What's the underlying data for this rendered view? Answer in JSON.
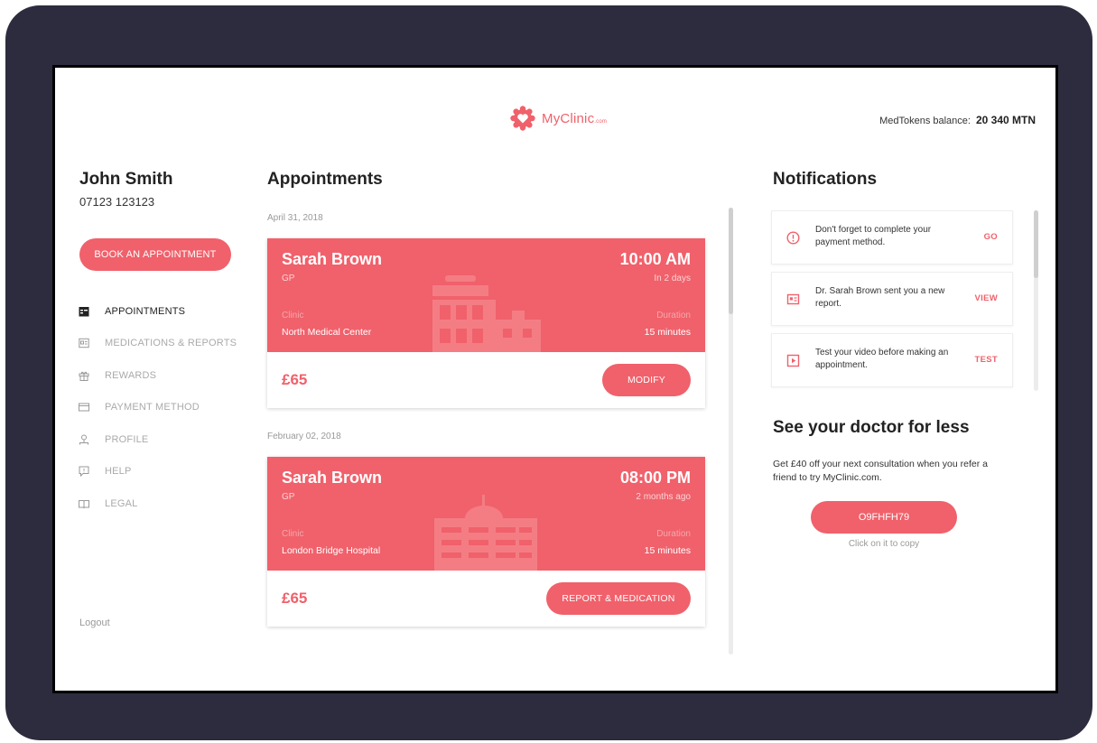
{
  "header": {
    "logo_text": "MyClinic",
    "logo_suffix": ".com",
    "balance_label": "MedTokens balance:",
    "balance_value": "20 340 MTN"
  },
  "user": {
    "name": "John Smith",
    "phone": "07123 123123"
  },
  "sidebar": {
    "book_label": "BOOK AN APPOINTMENT",
    "items": [
      {
        "label": "APPOINTMENTS",
        "icon": "calendar-icon",
        "active": true
      },
      {
        "label": "MEDICATIONS & REPORTS",
        "icon": "report-icon",
        "active": false
      },
      {
        "label": "REWARDS",
        "icon": "gift-icon",
        "active": false
      },
      {
        "label": "PAYMENT METHOD",
        "icon": "card-icon",
        "active": false
      },
      {
        "label": "PROFILE",
        "icon": "user-icon",
        "active": false
      },
      {
        "label": "HELP",
        "icon": "help-icon",
        "active": false
      },
      {
        "label": "LEGAL",
        "icon": "book-icon",
        "active": false
      }
    ],
    "logout_label": "Logout"
  },
  "appointments": {
    "title": "Appointments",
    "items": [
      {
        "date": "April 31, 2018",
        "doctor": "Sarah Brown",
        "type": "GP",
        "time": "10:00 AM",
        "relative": "In 2 days",
        "clinic_label": "Clinic",
        "clinic": "North Medical Center",
        "duration_label": "Duration",
        "duration": "15 minutes",
        "price": "£65",
        "action": "MODIFY"
      },
      {
        "date": "February 02, 2018",
        "doctor": "Sarah Brown",
        "type": "GP",
        "time": "08:00 PM",
        "relative": "2 months ago",
        "clinic_label": "Clinic",
        "clinic": "London Bridge Hospital",
        "duration_label": "Duration",
        "duration": "15 minutes",
        "price": "£65",
        "action": "REPORT & MEDICATION"
      }
    ]
  },
  "notifications": {
    "title": "Notifications",
    "items": [
      {
        "icon": "info-icon",
        "text": "Don't forget to complete your payment method.",
        "action": "GO"
      },
      {
        "icon": "report-icon",
        "text": "Dr. Sarah Brown sent you a new report.",
        "action": "VIEW"
      },
      {
        "icon": "video-icon",
        "text": "Test your video before making an appointment.",
        "action": "TEST"
      }
    ]
  },
  "referral": {
    "title": "See your doctor for less",
    "text": "Get £40 off your next consultation when you refer a friend to try MyClinic.com.",
    "code": "O9FHFH79",
    "hint": "Click on it to copy"
  },
  "colors": {
    "accent": "#f0616b",
    "frame": "#2c2c3e"
  }
}
